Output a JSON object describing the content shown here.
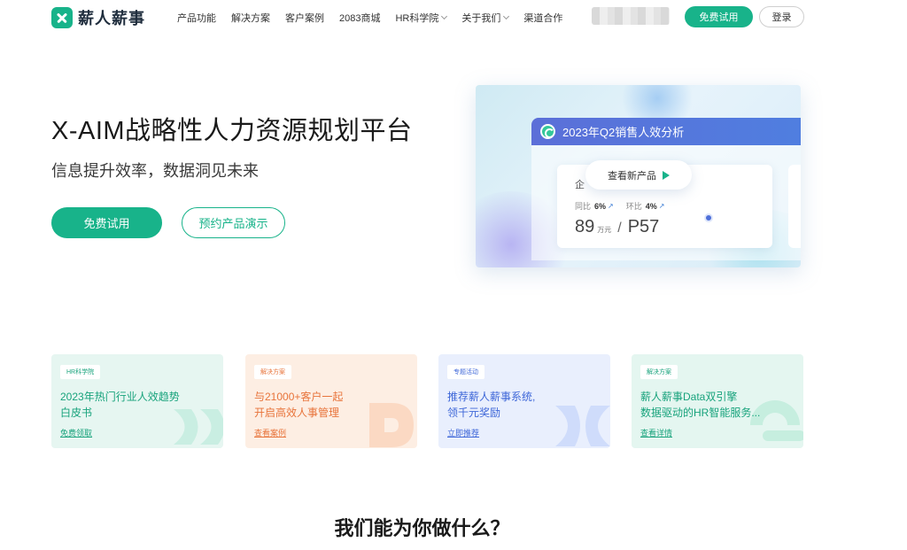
{
  "brand": {
    "name": "薪人薪事",
    "color": "#18b38a"
  },
  "nav": {
    "items": [
      {
        "label": "产品功能",
        "has_dropdown": false
      },
      {
        "label": "解决方案",
        "has_dropdown": false
      },
      {
        "label": "客户案例",
        "has_dropdown": false
      },
      {
        "label": "2083商城",
        "has_dropdown": false
      },
      {
        "label": "HR科学院",
        "has_dropdown": true
      },
      {
        "label": "关于我们",
        "has_dropdown": true
      },
      {
        "label": "渠道合作",
        "has_dropdown": false
      }
    ],
    "trial_label": "免费试用",
    "login_label": "登录"
  },
  "hero": {
    "title": "X-AIM战略性人力资源规划平台",
    "subtitle": "信息提升效率，数据洞见未来",
    "primary_cta": "免费试用",
    "secondary_cta": "预约产品演示",
    "dashboard": {
      "panel_title": "2023年Q2销售人效分析",
      "enterprise_label": "企",
      "yoy_label": "同比",
      "yoy_value": "6%",
      "mom_label": "环比",
      "mom_value": "4%",
      "main_value": "89",
      "main_unit": "万元",
      "separator": "/",
      "rank_value": "P57",
      "view_label": "查看新产品"
    }
  },
  "cards": [
    {
      "tag": "HR科学院",
      "title_lines": [
        "2023年热门行业人效趋势",
        "白皮书"
      ],
      "link": "免费领取",
      "accent": "#18a37c"
    },
    {
      "tag": "解决方案",
      "title_lines": [
        "与21000+客户一起",
        "开启高效人事管理"
      ],
      "link": "查看案例",
      "accent": "#e8743b"
    },
    {
      "tag": "专题活动",
      "title_lines": [
        "推荐薪人薪事系统,",
        "领千元奖励"
      ],
      "link": "立即推荐",
      "accent": "#3d66d8"
    },
    {
      "tag": "解决方案",
      "title_lines": [
        "薪人薪事Data双引擎",
        "数据驱动的HR智能服务..."
      ],
      "link": "查看详情",
      "accent": "#18a37c"
    }
  ],
  "section": {
    "title": "我们能为你做什么？"
  }
}
